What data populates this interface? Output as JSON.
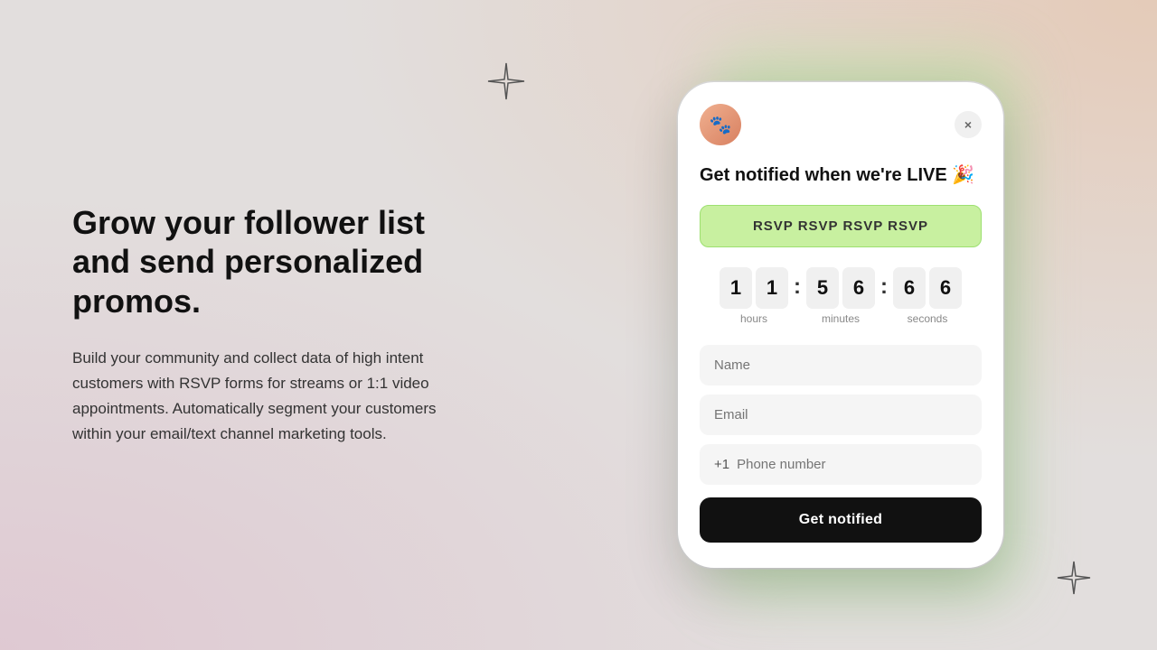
{
  "background": {
    "color": "#e2dedd"
  },
  "left": {
    "heading": "Grow your follower list and send personalized promos.",
    "body": "Build your community and collect data of high intent customers with RSVP forms for streams or 1:1 video appointments. Automatically segment your customers within your email/text channel marketing tools."
  },
  "phone": {
    "close_label": "×",
    "card_heading": "Get notified when we're LIVE 🎉",
    "rsvp_button": "RSVP RSVP RSVP RSVP",
    "countdown": {
      "hours_digits": [
        "1",
        "1"
      ],
      "minutes_digits": [
        "5",
        "6"
      ],
      "seconds_digits": [
        "6",
        "6"
      ],
      "hours_label": "hours",
      "minutes_label": "minutes",
      "seconds_label": "seconds",
      "separator": ":"
    },
    "form": {
      "name_placeholder": "Name",
      "email_placeholder": "Email",
      "phone_prefix": "+1",
      "phone_placeholder": "Phone number"
    },
    "notify_button": "Get notified"
  },
  "icons": {
    "close": "×",
    "star": "star-icon"
  }
}
